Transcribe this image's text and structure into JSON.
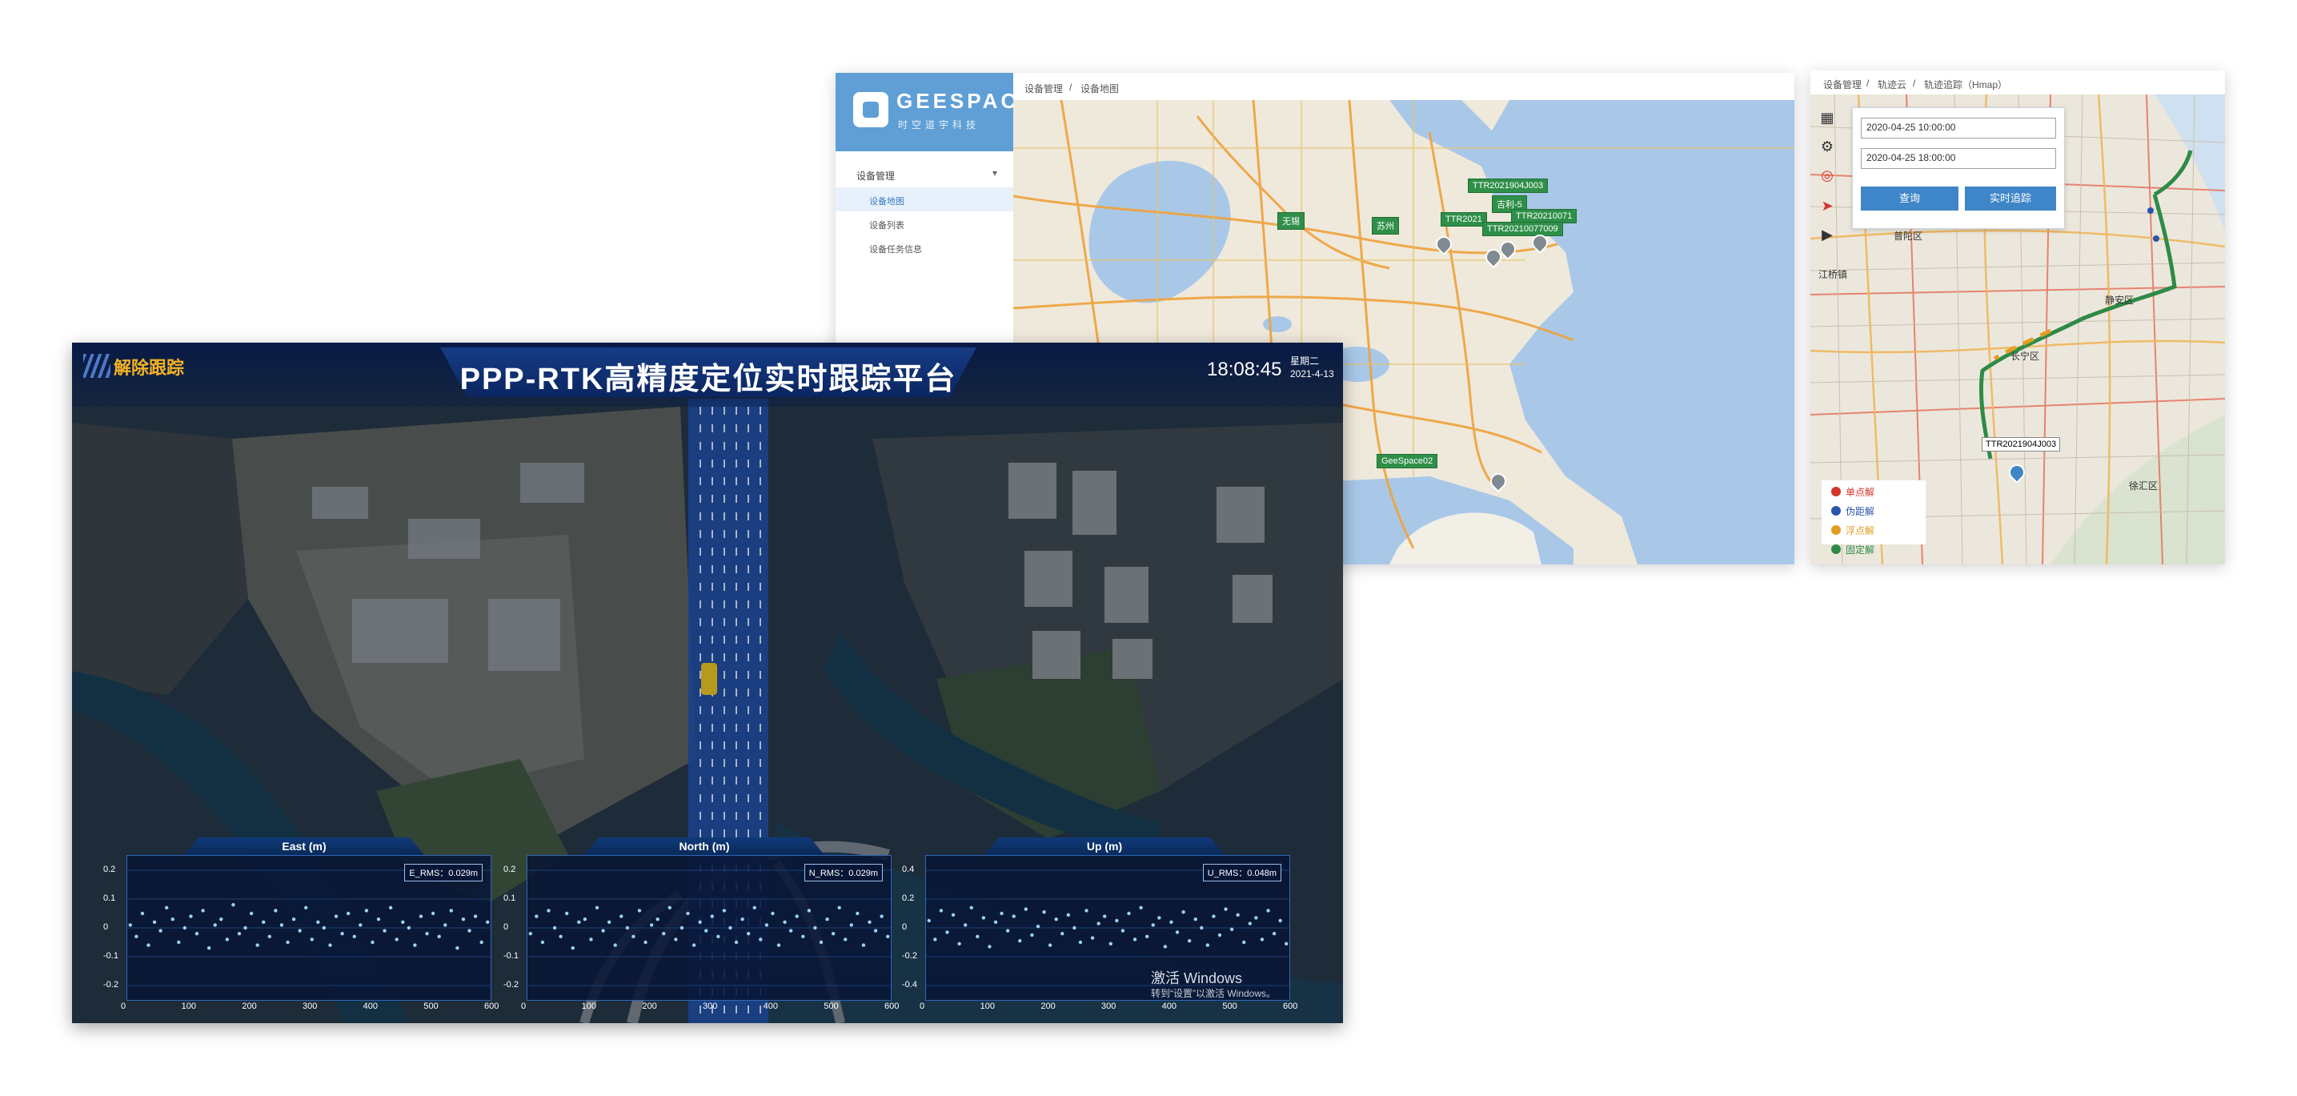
{
  "device_map_window": {
    "logo": {
      "text": "GEESPACE",
      "subtitle": "时空道宇科技"
    },
    "breadcrumb": [
      "设备管理",
      "设备地图"
    ],
    "sidebar": {
      "group": "设备管理",
      "items": [
        {
          "label": "设备地图",
          "active": true
        },
        {
          "label": "设备列表",
          "active": false
        },
        {
          "label": "设备任务信息",
          "active": false
        }
      ]
    },
    "map_markers": [
      "TTR2021904J003",
      "吉利-5",
      "TTR20210071",
      "TTR2021",
      "TTR20210077009",
      "GeeSpace02"
    ],
    "map_places": [
      "无锡",
      "苏州"
    ]
  },
  "track_window": {
    "breadcrumb": [
      "设备管理",
      "轨迹云",
      "轨迹追踪（Hmap）"
    ],
    "query": {
      "start_time": "2020-04-25 10:00:00",
      "end_time": "2020-04-25 18:00:00",
      "search_button": "查询",
      "realtime_button": "实时追踪"
    },
    "map_places": [
      "普陀区",
      "静安区",
      "长宁区",
      "江桥镇",
      "徐汇区"
    ],
    "device_label": "TTR2021904J003",
    "legend": [
      {
        "label": "单点解",
        "color": "#d6332b"
      },
      {
        "label": "伪距解",
        "color": "#2a55a8"
      },
      {
        "label": "浮点解",
        "color": "#e39d25"
      },
      {
        "label": "固定解",
        "color": "#2e8b47"
      }
    ],
    "toolbar_icons": [
      "map-icon",
      "gear-icon",
      "target-icon",
      "navigate-icon",
      "play-icon"
    ]
  },
  "dashboard": {
    "title": "PPP-RTK高精度定位实时跟踪平台",
    "untrack_button": "解除跟踪",
    "clock": "18:08:45",
    "weekday": "星期二",
    "date": "2021-4-13",
    "watermark": {
      "line1": "激活 Windows",
      "line2": "转到“设置”以激活 Windows。"
    }
  },
  "chart_data": [
    {
      "type": "scatter",
      "title": "East (m)",
      "rms": "E_RMS：0.029m",
      "xlim": [
        0,
        600
      ],
      "ylim": [
        -0.2,
        0.2
      ],
      "xticks": [
        "0",
        "100",
        "200",
        "300",
        "400",
        "500",
        "600"
      ],
      "yticks": [
        "0.2",
        "0.1",
        "0",
        "-0.1",
        "-0.2"
      ],
      "series": [
        {
          "x": [
            5,
            15,
            25,
            35,
            45,
            55,
            65,
            75,
            85,
            95,
            105,
            115,
            125,
            135,
            145,
            155,
            165,
            175,
            185,
            195,
            205,
            215,
            225,
            235,
            245,
            255,
            265,
            275,
            285,
            295,
            305,
            315,
            325,
            335,
            345,
            355,
            365,
            375,
            385,
            395,
            405,
            415,
            425,
            435,
            445,
            455,
            465,
            475,
            485,
            495,
            505,
            515,
            525,
            535,
            545,
            555,
            565,
            575,
            585,
            595
          ],
          "y": [
            0.01,
            -0.03,
            0.05,
            -0.06,
            0.02,
            -0.01,
            0.07,
            0.03,
            -0.05,
            0.0,
            0.04,
            -0.02,
            0.06,
            -0.07,
            0.01,
            0.03,
            -0.04,
            0.08,
            -0.02,
            0.0,
            0.05,
            -0.06,
            0.02,
            -0.03,
            0.06,
            0.01,
            -0.05,
            0.03,
            -0.01,
            0.07,
            -0.04,
            0.02,
            0.0,
            -0.06,
            0.04,
            -0.02,
            0.05,
            -0.03,
            0.01,
            0.06,
            -0.05,
            0.03,
            -0.01,
            0.07,
            -0.04,
            0.02,
            0.0,
            -0.06,
            0.04,
            -0.02,
            0.05,
            -0.03,
            0.01,
            0.06,
            -0.07,
            0.03,
            -0.01,
            0.04,
            -0.05,
            0.02
          ]
        }
      ]
    },
    {
      "type": "scatter",
      "title": "North (m)",
      "rms": "N_RMS：0.029m",
      "xlim": [
        0,
        600
      ],
      "ylim": [
        -0.2,
        0.2
      ],
      "xticks": [
        "0",
        "100",
        "200",
        "300",
        "400",
        "500",
        "600"
      ],
      "yticks": [
        "0.2",
        "0.1",
        "0",
        "-0.1",
        "-0.2"
      ],
      "series": [
        {
          "x": [
            5,
            15,
            25,
            35,
            45,
            55,
            65,
            75,
            85,
            95,
            105,
            115,
            125,
            135,
            145,
            155,
            165,
            175,
            185,
            195,
            205,
            215,
            225,
            235,
            245,
            255,
            265,
            275,
            285,
            295,
            305,
            315,
            325,
            335,
            345,
            355,
            365,
            375,
            385,
            395,
            405,
            415,
            425,
            435,
            445,
            455,
            465,
            475,
            485,
            495,
            505,
            515,
            525,
            535,
            545,
            555,
            565,
            575,
            585,
            595
          ],
          "y": [
            -0.02,
            0.04,
            -0.05,
            0.06,
            0.0,
            -0.03,
            0.05,
            -0.07,
            0.02,
            0.03,
            -0.04,
            0.07,
            -0.01,
            0.02,
            -0.06,
            0.04,
            0.0,
            -0.03,
            0.06,
            -0.05,
            0.01,
            0.03,
            -0.02,
            0.07,
            -0.04,
            0.0,
            0.05,
            -0.06,
            0.02,
            -0.01,
            0.04,
            -0.03,
            0.06,
            0.0,
            -0.05,
            0.03,
            -0.02,
            0.07,
            -0.04,
            0.01,
            0.05,
            -0.06,
            0.02,
            -0.01,
            0.04,
            -0.03,
            0.06,
            0.0,
            -0.05,
            0.03,
            -0.02,
            0.07,
            -0.04,
            0.01,
            0.05,
            -0.06,
            0.02,
            -0.01,
            0.04,
            -0.03
          ]
        }
      ]
    },
    {
      "type": "scatter",
      "title": "Up (m)",
      "rms": "U_RMS：0.048m",
      "xlim": [
        0,
        600
      ],
      "ylim": [
        -0.4,
        0.4
      ],
      "xticks": [
        "0",
        "100",
        "200",
        "300",
        "400",
        "500",
        "600"
      ],
      "yticks": [
        "0.4",
        "0.2",
        "0",
        "-0.2",
        "-0.4"
      ],
      "series": [
        {
          "x": [
            5,
            15,
            25,
            35,
            45,
            55,
            65,
            75,
            85,
            95,
            105,
            115,
            125,
            135,
            145,
            155,
            165,
            175,
            185,
            195,
            205,
            215,
            225,
            235,
            245,
            255,
            265,
            275,
            285,
            295,
            305,
            315,
            325,
            335,
            345,
            355,
            365,
            375,
            385,
            395,
            405,
            415,
            425,
            435,
            445,
            455,
            465,
            475,
            485,
            495,
            505,
            515,
            525,
            535,
            545,
            555,
            565,
            575,
            585,
            595
          ],
          "y": [
            0.05,
            -0.08,
            0.12,
            -0.03,
            0.09,
            -0.11,
            0.02,
            0.14,
            -0.06,
            0.07,
            -0.13,
            0.04,
            0.1,
            -0.02,
            0.08,
            -0.09,
            0.13,
            -0.05,
            0.01,
            0.11,
            -0.12,
            0.06,
            -0.04,
            0.09,
            0.0,
            -0.1,
            0.12,
            -0.07,
            0.03,
            0.08,
            -0.11,
            0.05,
            -0.02,
            0.1,
            -0.08,
            0.14,
            -0.06,
            0.02,
            0.07,
            -0.13,
            0.04,
            -0.03,
            0.11,
            -0.09,
            0.06,
            0.0,
            -0.12,
            0.08,
            -0.05,
            0.13,
            -0.01,
            0.09,
            -0.1,
            0.03,
            0.07,
            -0.08,
            0.12,
            -0.04,
            0.05,
            -0.11
          ]
        }
      ]
    }
  ]
}
